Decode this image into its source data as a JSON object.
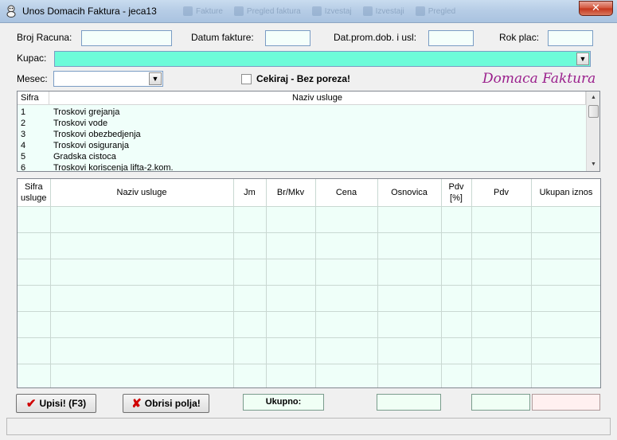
{
  "window": {
    "title": "Unos Domacih Faktura - jeca13",
    "close_label": "✕",
    "background_tabs": [
      "Fakture",
      "Pregled faktura",
      "Izvestaj",
      "Izvestaji",
      "Pregled"
    ]
  },
  "form": {
    "broj_racuna_label": "Broj Racuna:",
    "broj_racuna_value": "",
    "datum_fakture_label": "Datum fakture:",
    "datum_fakture_value": "",
    "dat_prom_label": "Dat.prom.dob. i usl:",
    "dat_prom_value": "",
    "rok_plac_label": "Rok plac:",
    "rok_plac_value": "",
    "kupac_label": "Kupac:",
    "kupac_value": "",
    "mesec_label": "Mesec:",
    "mesec_value": "",
    "cekiraj_label": "Cekiraj - Bez poreza!",
    "cekiraj_checked": false,
    "brand": "Domaca Faktura"
  },
  "services": {
    "columns": [
      "Sifra",
      "Naziv  usluge"
    ],
    "rows": [
      {
        "code": "1",
        "name": "Troskovi grejanja"
      },
      {
        "code": "2",
        "name": "Troskovi vode"
      },
      {
        "code": "3",
        "name": "Troskovi obezbedjenja"
      },
      {
        "code": "4",
        "name": "Troskovi osiguranja"
      },
      {
        "code": "5",
        "name": "Gradska cistoca"
      },
      {
        "code": "6",
        "name": "Troskovi koriscenja lifta-2.kom."
      }
    ]
  },
  "grid": {
    "col1_line1": "Sifra",
    "col1_line2": "usluge",
    "col2": "Naziv usluge",
    "col3": "Jm",
    "col4": "Br/Mkv",
    "col5": "Cena",
    "col6": "Osnovica",
    "col7_line1": "Pdv",
    "col7_line2": "[%]",
    "col8": "Pdv",
    "col9": "Ukupan iznos",
    "empty_rows": 7
  },
  "footer": {
    "save_button": "Upisi! (F3)",
    "clear_button": "Obrisi polja!",
    "total_label": "Ukupno:",
    "total_osnovica": "",
    "total_pdv": "",
    "total_ukupno": ""
  },
  "colors": {
    "kupac_bg": "#6dfbd9",
    "brand": "#9a1e8c",
    "save_icon": "#d00000",
    "clear_icon": "#d00000",
    "total_pink": "#fff0f0"
  }
}
